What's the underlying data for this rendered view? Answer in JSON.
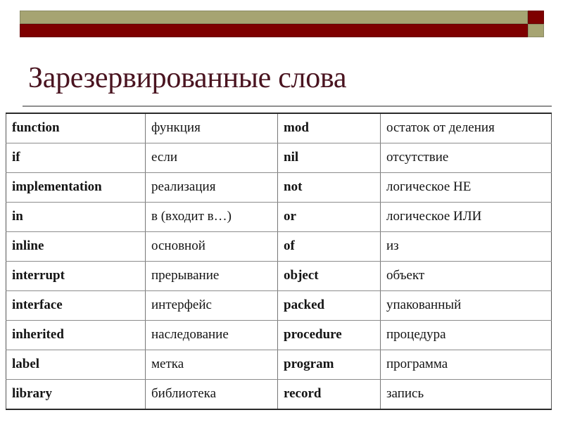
{
  "header": {
    "decoration": {
      "olive_color": "#a6a472",
      "red_color": "#7e0000"
    }
  },
  "slide": {
    "title": "Зарезервированные слова",
    "title_color": "#4a1420",
    "keyword_color": "#6d0fc4"
  },
  "table": {
    "rows": [
      {
        "keyword_a": "function",
        "translation_a": "функция",
        "keyword_b": "mod",
        "translation_b": "остаток от деления"
      },
      {
        "keyword_a": "if",
        "translation_a": "если",
        "keyword_b": "nil",
        "translation_b": "отсутствие"
      },
      {
        "keyword_a": "implementation",
        "translation_a": "реализация",
        "keyword_b": "not",
        "translation_b": "логическое НЕ"
      },
      {
        "keyword_a": "in",
        "translation_a": "в (входит в…)",
        "keyword_b": "or",
        "translation_b": "логическое ИЛИ"
      },
      {
        "keyword_a": "inline",
        "translation_a": "основной",
        "keyword_b": "of",
        "translation_b": "из"
      },
      {
        "keyword_a": "interrupt",
        "translation_a": "прерывание",
        "keyword_b": "object",
        "translation_b": "объект"
      },
      {
        "keyword_a": "interface",
        "translation_a": "интерфейс",
        "keyword_b": "packed",
        "translation_b": "упакованный"
      },
      {
        "keyword_a": "inherited",
        "translation_a": "наследование",
        "keyword_b": "procedure",
        "translation_b": "процедура"
      },
      {
        "keyword_a": "label",
        "translation_a": "метка",
        "keyword_b": "program",
        "translation_b": "программа"
      },
      {
        "keyword_a": "library",
        "translation_a": "библиотека",
        "keyword_b": "record",
        "translation_b": "запись"
      }
    ]
  }
}
